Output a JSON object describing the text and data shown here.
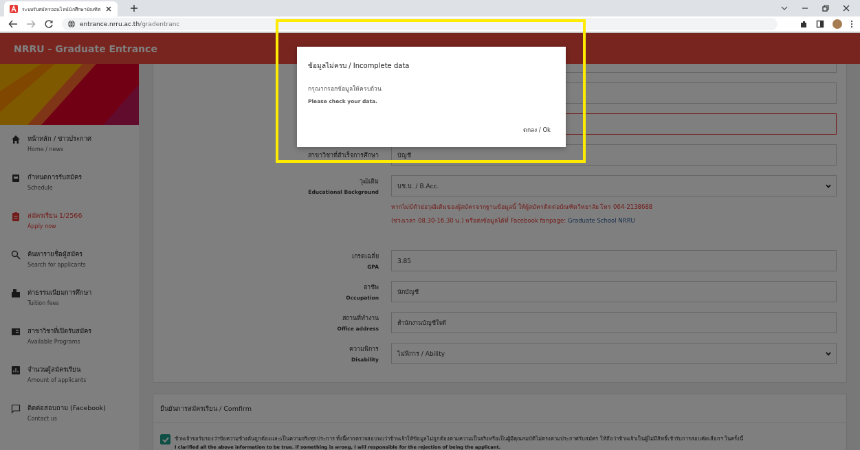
{
  "browser": {
    "tab_title": "ระบบรับสมัครออนไลน์นักศึกษาบัณฑิต",
    "url_host": "entrance.nrru.ac.th",
    "url_path": "/gradentranc"
  },
  "app": {
    "title": "NRRU - Graduate Entrance"
  },
  "sidebar": {
    "items": [
      {
        "th": "หน้าหลัก / ข่าวประกาศ",
        "en": "Home / news",
        "selected": false
      },
      {
        "th": "กำหนดการรับสมัคร",
        "en": "Schedule",
        "selected": false
      },
      {
        "th": "สมัครเรียน 1/2566",
        "en": "Apply now",
        "selected": true
      },
      {
        "th": "ค้นหารายชื่อผู้สมัคร",
        "en": "Search for applicants",
        "selected": false
      },
      {
        "th": "ค่าธรรมเนียมการศึกษา",
        "en": "Tuition fees",
        "selected": false
      },
      {
        "th": "สาขาวิชาที่เปิดรับสมัคร",
        "en": "Available Programs",
        "selected": false
      },
      {
        "th": "จำนวนผู้สมัครเรียน",
        "en": "Amount of applicants",
        "selected": false
      },
      {
        "th": "ติดต่อสอบถาม (Facebook)",
        "en": "Contact us",
        "selected": false
      }
    ]
  },
  "form": {
    "fields": [
      {
        "kind": "text",
        "error": false
      },
      {
        "kind": "text",
        "error": false
      },
      {
        "kind": "text",
        "error": true
      },
      {
        "kind": "text",
        "label_th": "สาขาวิชาที่สำเร็จการศึกษา",
        "value": "บัญชี",
        "error": false
      },
      {
        "kind": "select",
        "label_th": "วุฒิเดิม",
        "label_en": "Educational Background",
        "value": "บช.บ. / B.Acc.",
        "error": false
      },
      {
        "kind": "hint",
        "lines": [
          "หากไม่มีตัวย่อวุฒิเดิมของผู้สมัครจากฐานข้อมูลนี้ ให้ผู้สมัครติดต่อบัณฑิตวิทยาลัย โทร 064-2138688",
          "(ช่วงเวลา 08.30-16.30 น.) หรือส่งข้อมูลได้ที่ Facebook fanpage: "
        ],
        "link": "Graduate School NRRU"
      },
      {
        "kind": "text",
        "label_th": "เกรดเฉลี่ย",
        "label_en": "GPA",
        "value": "3.85",
        "error": false
      },
      {
        "kind": "text",
        "label_th": "อาชีพ",
        "label_en": "Occupation",
        "value": "นักบัญชี",
        "error": false
      },
      {
        "kind": "text",
        "label_th": "สถานที่ทำงาน",
        "label_en": "Office address",
        "value": "สำนักงานบัญชีใจดี",
        "error": false
      },
      {
        "kind": "select",
        "label_th": "ความพิการ",
        "label_en": "Disability",
        "value": "ไม่พิการ / Ability",
        "error": false
      }
    ]
  },
  "confirm": {
    "title": "ยืนยันการสมัครเรียน / Comfirm",
    "checked": true,
    "text_th": "ข้าพเจ้าขอรับรองว่าข้อความข้างต้นถูกต้องและเป็นความจริงทุกประการ ทั้งนี้หากตรวจสอบพบว่าข้าพเจ้าให้ข้อมูลไม่ถูกต้องตามความเป็นจริงหรือเป็นผู้มีคุณสมบัติไม่ตรงตามประกาศรับสมัคร ให้ถือว่าข้าพเจ้าเป็นผู้ไม่มีสิทธิ์เข้ารับการสอบคัดเลือกฯ ในครั้งนี้",
    "text_en": "I clarified all the above information to be true. if something is wrong, I will responsible for the rejection of being the applicant."
  },
  "dialog": {
    "title": "ข้อมูลไม่ครบ / Incomplete data",
    "message_th": "กรุณากรอกข้อมูลให้ครบถ้วน",
    "message_en": "Please check your data.",
    "button": "ตกลง / Ok"
  }
}
